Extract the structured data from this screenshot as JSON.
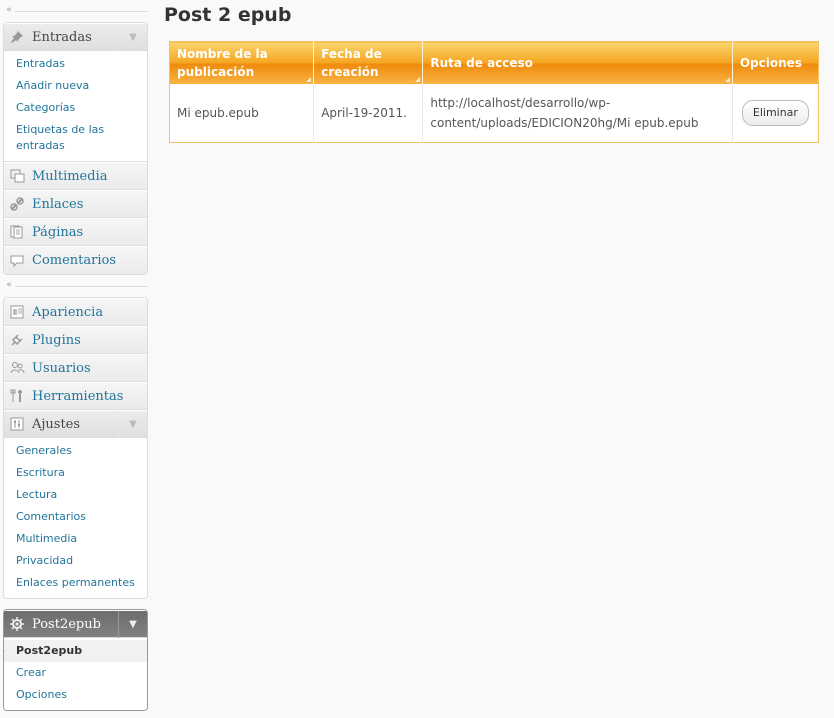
{
  "sidebar": {
    "group1": [
      {
        "label": "Entradas",
        "icon": "pushpin-icon",
        "open": true,
        "submenu": [
          "Entradas",
          "Añadir nueva",
          "Categorías",
          "Etiquetas de las entradas"
        ]
      },
      {
        "label": "Multimedia",
        "icon": "media-icon"
      },
      {
        "label": "Enlaces",
        "icon": "link-icon"
      },
      {
        "label": "Páginas",
        "icon": "pages-icon"
      },
      {
        "label": "Comentarios",
        "icon": "comment-icon"
      }
    ],
    "group2": [
      {
        "label": "Apariencia",
        "icon": "appearance-icon"
      },
      {
        "label": "Plugins",
        "icon": "plugin-icon"
      },
      {
        "label": "Usuarios",
        "icon": "users-icon"
      },
      {
        "label": "Herramientas",
        "icon": "tools-icon"
      },
      {
        "label": "Ajustes",
        "icon": "settings-icon",
        "open": true,
        "submenu": [
          "Generales",
          "Escritura",
          "Lectura",
          "Comentarios",
          "Multimedia",
          "Privacidad",
          "Enlaces permanentes"
        ]
      }
    ],
    "group3": {
      "label": "Post2epub",
      "icon": "gear-icon",
      "submenu": [
        "Post2epub",
        "Crear",
        "Opciones"
      ],
      "current": "Post2epub"
    }
  },
  "main": {
    "title": "Post 2 epub",
    "table": {
      "headers": [
        "Nombre de la publicación",
        "Fecha de creación",
        "Ruta de acceso",
        "Opciones"
      ],
      "rows": [
        {
          "nombre": "Mi epub.epub",
          "fecha": "April-19-2011.",
          "ruta": "http://localhost/desarrollo/wp-content/uploads/EDICION20hg/Mi epub.epub",
          "accion": "Eliminar"
        }
      ]
    }
  },
  "colors": {
    "link": "#21759b",
    "header_orange": "#f6a623",
    "menu_dark": "#6d6d6d"
  }
}
